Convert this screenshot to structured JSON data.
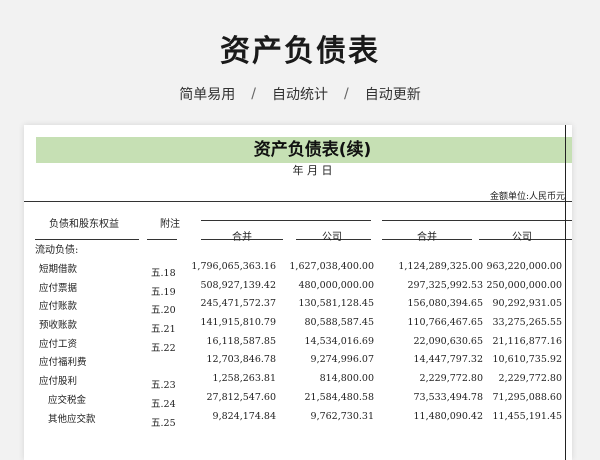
{
  "page": {
    "title": "资产负债表",
    "features": [
      "简单易用",
      "自动统计",
      "自动更新"
    ],
    "separator": "/"
  },
  "sheet": {
    "title": "资产负债表(续)",
    "date_label": "年 月 日",
    "unit_label": "金额单位:人民币元",
    "header": {
      "item": "负债和股东权益",
      "note": "附注",
      "cols": [
        "合并",
        "公司",
        "合并",
        "公司"
      ]
    },
    "section_label": "流动负债:",
    "rows": [
      {
        "name": "短期借款",
        "note": "五.18",
        "v": [
          "1,796,065,363.16",
          "1,627,038,400.00",
          "1,124,289,325.00",
          "963,220,000.00"
        ]
      },
      {
        "name": "应付票据",
        "note": "五.19",
        "v": [
          "508,927,139.42",
          "480,000,000.00",
          "297,325,992.53",
          "250,000,000.00"
        ]
      },
      {
        "name": "应付账款",
        "note": "五.20",
        "v": [
          "245,471,572.37",
          "130,581,128.45",
          "156,080,394.65",
          "90,292,931.05"
        ]
      },
      {
        "name": "预收账款",
        "note": "五.21",
        "v": [
          "141,915,810.79",
          "80,588,587.45",
          "110,766,467.65",
          "33,275,265.55"
        ]
      },
      {
        "name": "应付工资",
        "note": "五.22",
        "v": [
          "16,118,587.85",
          "14,534,016.69",
          "22,090,630.65",
          "21,116,877.16"
        ]
      },
      {
        "name": "应付福利费",
        "note": "",
        "v": [
          "12,703,846.78",
          "9,274,996.07",
          "14,447,797.32",
          "10,610,735.92"
        ]
      },
      {
        "name": "应付股利",
        "note": "五.23",
        "v": [
          "1,258,263.81",
          "814,800.00",
          "2,229,772.80",
          "2,229,772.80"
        ]
      },
      {
        "name": "应交税金",
        "note": "五.24",
        "v": [
          "27,812,547.60",
          "21,584,480.58",
          "73,533,494.78",
          "71,295,088.60"
        ]
      },
      {
        "name": "其他应交款",
        "note": "五.25",
        "v": [
          "9,824,174.84",
          "9,762,730.31",
          "11,480,090.42",
          "11,455,191.45"
        ]
      }
    ]
  },
  "colors": {
    "title_band": "#c6e0b4",
    "background": "#f2f2f2"
  }
}
